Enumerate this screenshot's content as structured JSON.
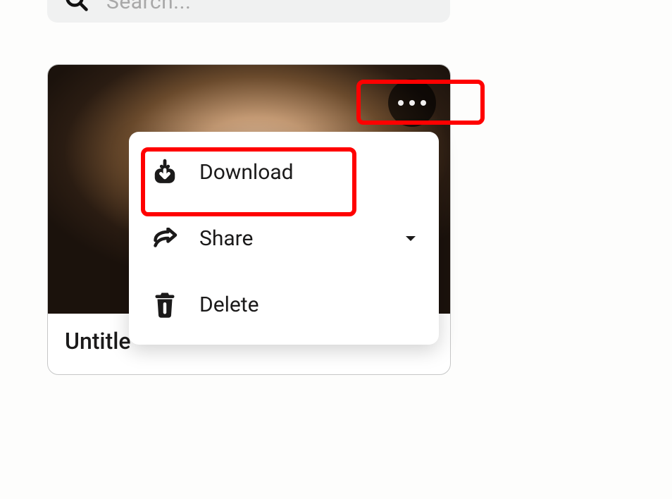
{
  "search": {
    "placeholder": "Search..."
  },
  "card": {
    "title": "Untitle"
  },
  "menu": {
    "download": "Download",
    "share": "Share",
    "delete": "Delete"
  }
}
